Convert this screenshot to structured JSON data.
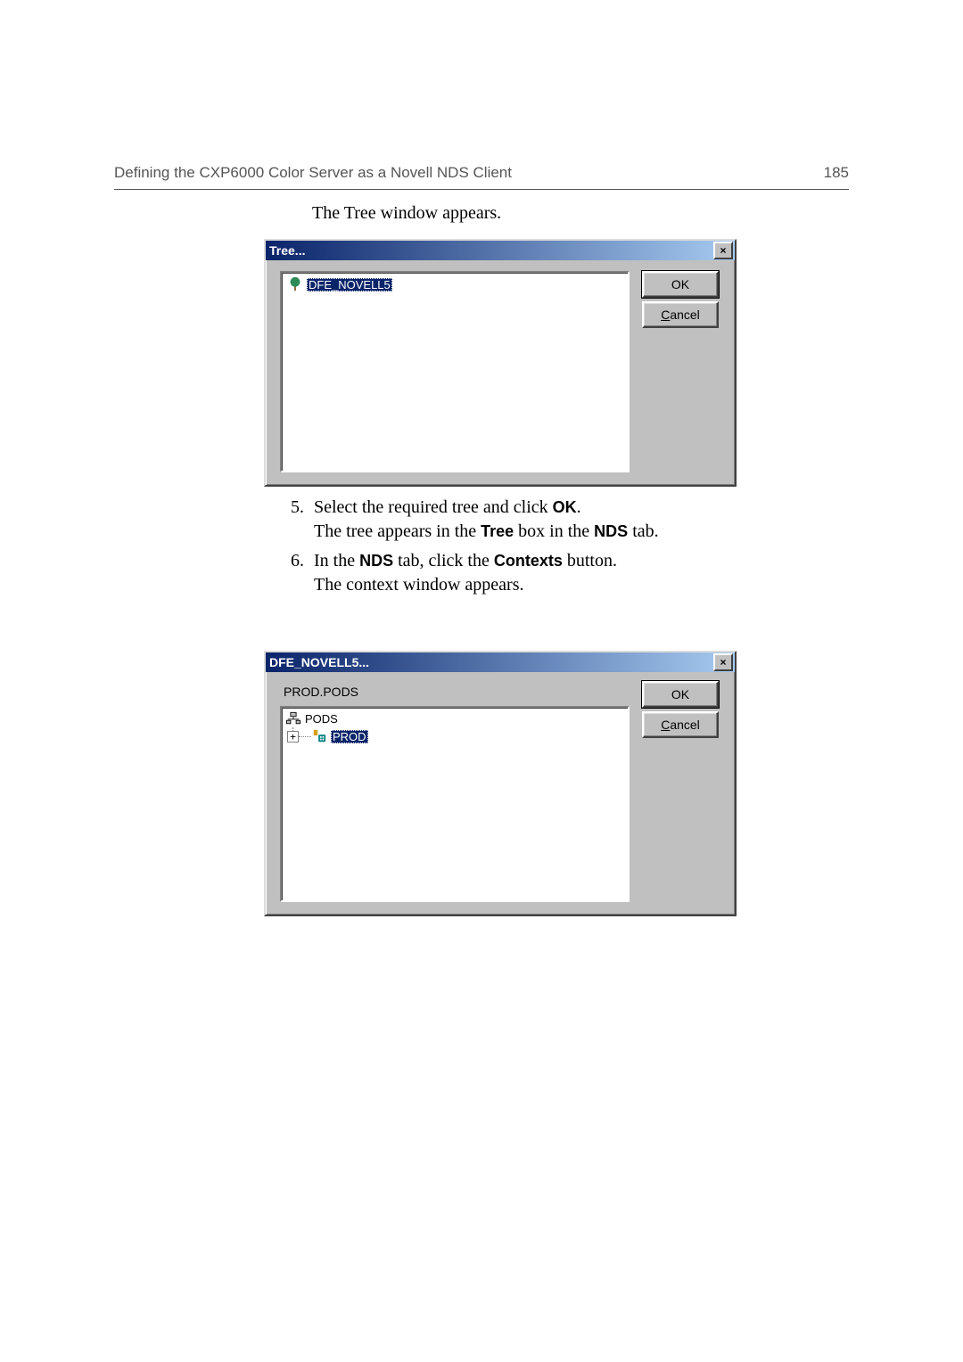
{
  "header": {
    "left": "Defining the CXP6000 Color Server as a Novell NDS Client",
    "page": "185"
  },
  "intro": "The Tree window appears.",
  "steps": {
    "s5_a": "Select the required tree and click ",
    "s5_ok": "OK",
    "s5_period": ".",
    "s5_b1": "The tree appears in the ",
    "s5_tree": "Tree",
    "s5_b2": " box in the ",
    "s5_nds": "NDS",
    "s5_b3": " tab.",
    "s6_a": "In the ",
    "s6_nds": "NDS",
    "s6_b": " tab, click the ",
    "s6_ctx": "Contexts",
    "s6_c": " button.",
    "s6_d": "The context window appears."
  },
  "dlg1": {
    "title": "Tree...",
    "close": "×",
    "ok": "OK",
    "cancel_pre": "C",
    "cancel_post": "ancel",
    "item": "DFE_NOVELL5"
  },
  "dlg2": {
    "title": "DFE_NOVELL5...",
    "close": "×",
    "ok": "OK",
    "cancel_pre": "C",
    "cancel_post": "ancel",
    "context_path": "PROD.PODS",
    "pods": "PODS",
    "prod": "PROD",
    "expand": "+"
  }
}
